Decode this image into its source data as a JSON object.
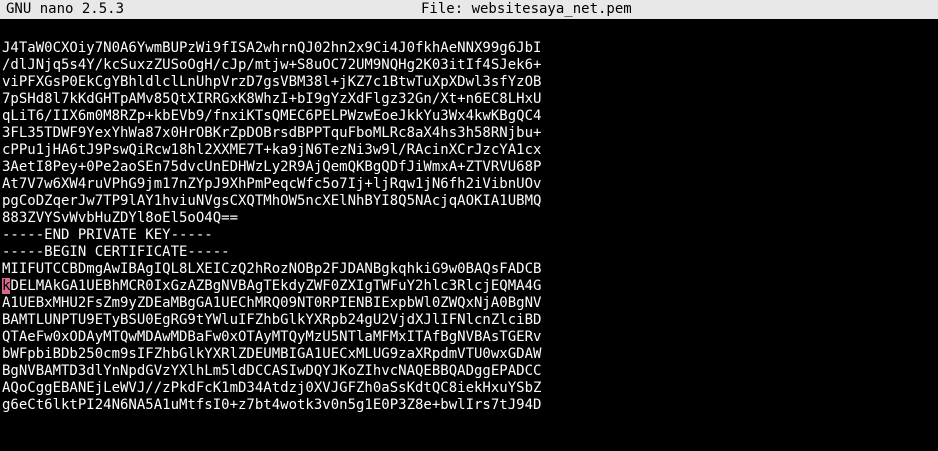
{
  "titlebar": {
    "app": "GNU nano 2.5.3",
    "file_label": "File: websitesaya_net.pem"
  },
  "editor": {
    "lines": [
      "J4TaW0CXOiy7N0A6YwmBUPzWi9fISA2whrnQJ02hn2x9Ci4J0fkhAeNNX99g6JbI",
      "/dlJNjq5s4Y/kcSuxzZUSoOgH/cJp/mtjw+S8uOC72UM9NQHg2K03itIf4SJek6+",
      "viPFXGsP0EkCgYBhldlclLnUhpVrzD7gsVBM38l+jKZ7c1BtwTuXpXDwl3sfYzOB",
      "7pSHd8l7kKdGHTpAMv85QtXIRRGxK8WhzI+bI9gYzXdFlgz32Gn/Xt+n6EC8LHxU",
      "qLiT6/IIX6m0M8RZp+kbEVb9/fnxiKTsQMEC6PELPWzwEoeJkkYu3Wx4kwKBgQC4",
      "3FL35TDWF9YexYhWa87x0HrOBKrZpDOBrsdBPPTquFboMLRc8aX4hs3h58RNjbu+",
      "cPPu1jHA6tJ9PswQiRcw18hl2XXME7T+ka9jN6TezNi3w9l/RAcinXCrJzcYA1cx",
      "3AetI8Pey+0Pe2aoSEn75dvcUnEDHWzLy2R9AjQemQKBgQDfJiWmxA+ZTVRVU68P",
      "At7V7w6XW4ruVPhG9jm17nZYpJ9XhPmPeqcWfc5o7Ij+ljRqw1jN6fh2iVibnUOv",
      "pgCoDZqerJw7TP9lAY1hviuNVgsCXQTMhOW5ncXElNhBYI8Q5NAcjqAOKIA1UBMQ",
      "883ZVYSvWvbHuZDYl8oEl5oO4Q==",
      "-----END PRIVATE KEY-----",
      "-----BEGIN CERTIFICATE-----",
      "MIIFUTCCBDmgAwIBAgIQL8LXEICzQ2hRozNOBp2FJDANBgkqhkiG9w0BAQsFADCB",
      "kDELMAkGA1UEBhMCR0IxGzAZBgNVBAgTEkdyZWF0ZXIgTWFuY2hlc3RlcjEQMA4G",
      "A1UEBxMHU2FsZm9yZDEaMBgGA1UEChMRQ09NT0RPIENBIExpbWl0ZWQxNjA0BgNV",
      "BAMTLUNPTU9ETyBSU0EgRG9tYWluIFZhbGlkYXRpb24gU2VjdXJlIFNlcnZlciBD",
      "QTAeFw0xODAyMTQwMDAwMDBaFw0xOTAyMTQyMzU5NTlaMFMxITAfBgNVBAsTGERv",
      "bWFpbiBDb250cm9sIFZhbGlkYXRlZDEUMBIGA1UECxMLUG9zaXRpdmVTU0wxGDAW",
      "BgNVBAMTD3dlYnNpdGVzYXlhLm5ldDCCASIwDQYJKoZIhvcNAQEBBQADggEPADCC",
      "AQoCggEBANEjLeWVJ//zPkdFcK1mD34Atdzj0XVJGFZh0aSsKdtQC8iekHxuYSbZ",
      "g6eCt6lktPI24N6NA5A1uMtfsI0+z7bt4wotk3v0n5g1E0P3Z8e+bwlIrs7tJ94D"
    ],
    "cursor": {
      "line": 14,
      "col": 0
    }
  },
  "colors": {
    "background": "#000000",
    "foreground": "#ffffff",
    "titlebar_bg": "#e8e8e8",
    "cursor_bg": "#d9678e"
  }
}
